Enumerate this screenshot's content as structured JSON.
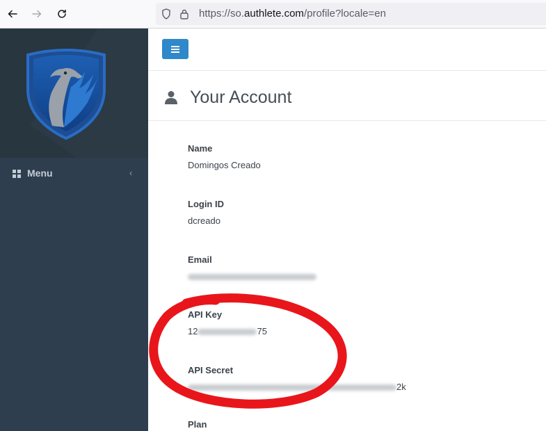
{
  "browser": {
    "url_prefix": "https://so.",
    "url_host": "authlete.com",
    "url_path": "/profile?locale=en"
  },
  "sidebar": {
    "menu_label": "Menu",
    "menu_chevron": "‹"
  },
  "header": {
    "title": "Your Account"
  },
  "profile": {
    "name_label": "Name",
    "name_value": "Domingos Creado",
    "login_label": "Login ID",
    "login_value": "dcreado",
    "email_label": "Email",
    "apikey_label": "API Key",
    "apikey_prefix": "12",
    "apikey_suffix": "75",
    "apisecret_label": "API Secret",
    "apisecret_suffix": "2k",
    "plan_label": "Plan"
  },
  "colors": {
    "sidebar": "#2e3e4e",
    "accent": "#2f88c9",
    "annotation": "#e8161b"
  }
}
